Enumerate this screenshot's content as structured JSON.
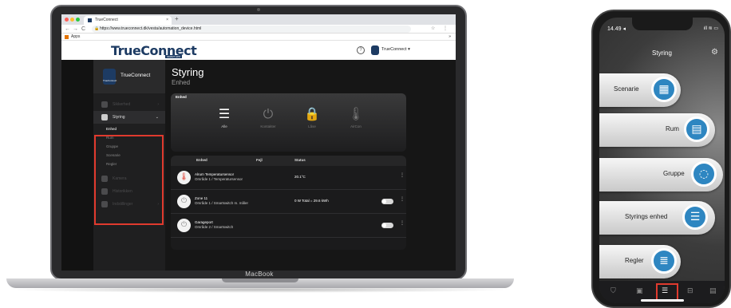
{
  "browser": {
    "tab_title": "TrueConnect",
    "tab_close": "×",
    "new_tab": "+",
    "nav_back": "←",
    "nav_forward": "→",
    "nav_reload": "C",
    "lock_glyph": "🔒",
    "url": "https://www.trueconnect.dk/vesta/automation_device.html",
    "bookmarks_label": "Apps",
    "right_icons": "☆ ⋮",
    "bookmarks_more": "»"
  },
  "header": {
    "logo_text": "TrueConnect",
    "logo_tagline": "SMART APP",
    "help_glyph": "?",
    "user_name": "TrueConnect ▾"
  },
  "sidebar": {
    "brand_name": "TrueConnect",
    "brand_logo_text": "TrueConnect",
    "items": [
      {
        "label": "Sikkerhed",
        "icon": "shield-icon"
      },
      {
        "label": "Styring",
        "icon": "sliders-icon",
        "active": true
      },
      {
        "label": "Kamera",
        "icon": "camera-icon"
      },
      {
        "label": "Historikken",
        "icon": "list-icon"
      },
      {
        "label": "Indstillinger",
        "icon": "gear-icon"
      }
    ],
    "subitems": [
      "Enhed",
      "Rum",
      "Gruppe",
      "Scenarie",
      "Regler"
    ],
    "chevron": "›",
    "chevron_open": "⌄"
  },
  "main": {
    "title": "Styring",
    "subtitle": "Enhed",
    "panel_label": "Enhed",
    "device_types": [
      {
        "label": "Alle",
        "glyph": "☰",
        "active": true
      },
      {
        "label": "Kontakter",
        "glyph": "⏻",
        "active": false
      },
      {
        "label": "Låse",
        "glyph": "🔒",
        "active": false
      },
      {
        "label": "AirCon",
        "glyph": "🌡",
        "active": false
      }
    ],
    "table": {
      "headers": [
        "Enhed",
        "Fejl",
        "Status"
      ],
      "rows": [
        {
          "name": "Alrum Temperatursensor",
          "sub": "Område 1 / Temperatursensor",
          "status": "20.1°C",
          "icon": "🌡",
          "toggle": false
        },
        {
          "name": "Zone 11",
          "sub": "Område 1 / Smartswitch m. måler",
          "status": "0 W  Total = 29.6 kWh",
          "icon": "⏻",
          "toggle": true
        },
        {
          "name": "Garageport",
          "sub": "Område 2 / Smartswitch",
          "status": "",
          "icon": "⏻",
          "toggle": true
        }
      ],
      "more_glyph": "⋮"
    }
  },
  "laptop": {
    "brand": "MacBook"
  },
  "phone": {
    "time": "14.49 ◂",
    "status_icons": "ıll ≋ ▭",
    "title": "Styring",
    "gear_glyph": "⚙",
    "buttons": [
      {
        "label": "Scenarie",
        "glyph": "▦"
      },
      {
        "label": "Rum",
        "glyph": "▤"
      },
      {
        "label": "Gruppe",
        "glyph": "◌"
      },
      {
        "label": "Styrings enhed",
        "glyph": "☰"
      },
      {
        "label": "Regler",
        "glyph": "≣"
      }
    ],
    "tabs": [
      "⛉",
      "▣",
      "☰",
      "⊟",
      "▤"
    ]
  },
  "colors": {
    "accent": "#1d3b63",
    "highlight": "#e03a2e",
    "icon_blue": "#2e86c1"
  }
}
